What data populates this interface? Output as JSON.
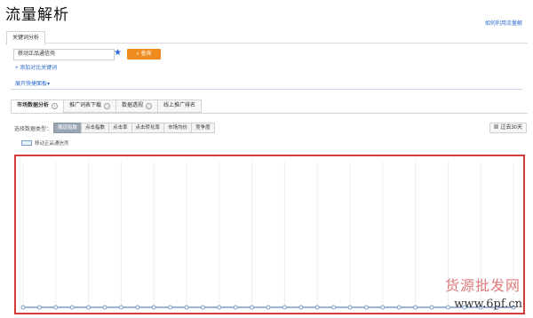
{
  "page": {
    "title": "流量解析",
    "help_link": "如何利用流量解"
  },
  "keyword_tab": {
    "label": "关键词分析"
  },
  "search": {
    "value": "移动正品通信壳",
    "button": "查询",
    "add_link": "+ 添加对比关键词",
    "quick_link": "展开快捷面板"
  },
  "tabs": [
    {
      "label": "市场数据分析",
      "active": true
    },
    {
      "label": "推广词表下载",
      "active": false
    },
    {
      "label": "数据透视",
      "active": false
    },
    {
      "label": "线上推广排名",
      "active": false
    }
  ],
  "data_type": {
    "label": "选择数据类型：",
    "options": [
      {
        "label": "展现指数",
        "active": true
      },
      {
        "label": "点击指数",
        "active": false
      },
      {
        "label": "点击率",
        "active": false
      },
      {
        "label": "点击转化率",
        "active": false
      },
      {
        "label": "市场均价",
        "active": false
      },
      {
        "label": "竞争度",
        "active": false
      }
    ],
    "period": "过去30天"
  },
  "chart_data": {
    "type": "line",
    "series": [
      {
        "name": "移动正品通信壳",
        "values": [
          0,
          0,
          0,
          0,
          0,
          0,
          0,
          0,
          0,
          0,
          0,
          0,
          0,
          0,
          0,
          0,
          0,
          0,
          0,
          0,
          0,
          0,
          0,
          0,
          0,
          0,
          0,
          0,
          0,
          0,
          0
        ]
      }
    ],
    "grid": true,
    "legend": "top-left",
    "colors": {
      "line": "#7a9ccc",
      "frame": "#d43c3c"
    }
  },
  "watermark": {
    "line1": "货源批发网",
    "line2": "www.6pf.cn"
  },
  "colors": {
    "accent": "#f08c1e",
    "link": "#2b6cd0"
  }
}
